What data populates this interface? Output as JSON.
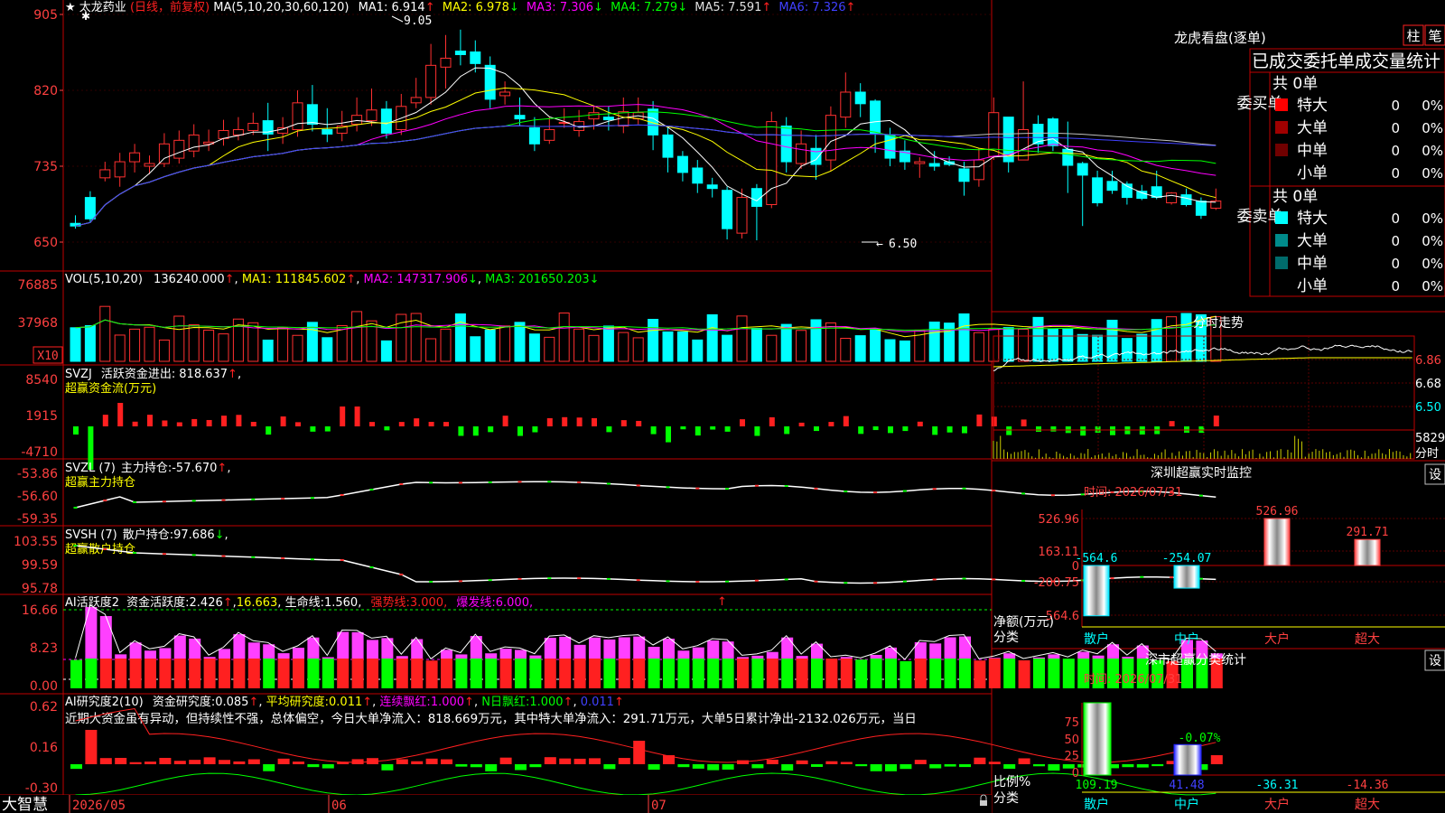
{
  "app": {
    "name": "大智慧",
    "date_start": "2026/05",
    "date_06": "06",
    "date_07": "07"
  },
  "stock": {
    "name": "太龙药业",
    "mode": "(日线，前复权)",
    "star": "★"
  },
  "price_panel": {
    "yticks": [
      "905",
      "820",
      "735",
      "650"
    ],
    "ma_label": "MA(5,10,20,30,60,120)",
    "ma": [
      {
        "name": "MA1",
        "value": "6.914",
        "arrow": "↑",
        "color": "#ffffff"
      },
      {
        "name": "MA2",
        "value": "6.978",
        "arrow": "↓",
        "color": "#ffff00"
      },
      {
        "name": "MA3",
        "value": "7.306",
        "arrow": "↓",
        "color": "#ff00ff"
      },
      {
        "name": "MA4",
        "value": "7.279",
        "arrow": "↓",
        "color": "#00ff00"
      },
      {
        "name": "MA5",
        "value": "7.591",
        "arrow": "↑",
        "color": "#c0c0c0"
      },
      {
        "name": "MA6",
        "value": "7.326",
        "arrow": "↑",
        "color": "#4040ff"
      }
    ],
    "high_mark": "9.05",
    "low_mark": "6.50"
  },
  "volume_panel": {
    "label": "VOL(5,10,20)",
    "value": "136240.000",
    "ma": [
      {
        "name": "MA1",
        "value": "111845.602",
        "arrow": "↑",
        "color": "#ffff00"
      },
      {
        "name": "MA2",
        "value": "147317.906",
        "arrow": "↓",
        "color": "#ff00ff"
      },
      {
        "name": "MA3",
        "value": "201650.203",
        "arrow": "↓",
        "color": "#00ff00"
      }
    ],
    "yticks": [
      "76885",
      "37968"
    ],
    "unit": "X10"
  },
  "svzj_panel": {
    "label": "SVZJ",
    "title": "活跃资金进出:",
    "value": "818.637",
    "subtitle": "超赢资金流(万元)",
    "yticks": [
      "8540",
      "1915",
      "-4710"
    ]
  },
  "svzl_panel": {
    "label": "SVZL (7)",
    "title": "主力持仓:",
    "value": "-57.670",
    "subtitle": "超赢主力持仓",
    "yticks": [
      "-53.86",
      "-56.60",
      "-59.35"
    ]
  },
  "svsh_panel": {
    "label": "SVSH (7)",
    "title": "散户持仓:",
    "value": "97.686",
    "subtitle": "超赢散户持仓",
    "yticks": [
      "103.55",
      "99.59",
      "95.78"
    ]
  },
  "ai_active_panel": {
    "label": "AI活跃度2",
    "title": "资金活跃度:",
    "value1": "2.426",
    "value2": "16.663",
    "life_label": "生命线:",
    "life_value": "1.560",
    "strong_label": "强势线:",
    "strong_value": "3.000",
    "burst_label": "爆发线:",
    "burst_value": "6.000",
    "yticks": [
      "16.66",
      "8.23",
      "0.00"
    ]
  },
  "ai_research_panel": {
    "label": "AI研究度2(10)",
    "title": "资金研究度:",
    "value": "0.085",
    "avg_label": "平均研究度:",
    "avg_value": "0.011",
    "red1_label": "连续飘红:",
    "red1_value": "1.000",
    "red2_label": "N日飘红:",
    "red2_value": "1.000",
    "last_value": "0.011",
    "comment": "近期大资金虽有异动，但持续性不强，总体偏空，今日大单净流入：818.669万元，其中特大单净流入：291.71万元，大单5日累计净出-2132.026万元，当日",
    "yticks": [
      "0.62",
      "0.16",
      "-0.30"
    ]
  },
  "lhb": {
    "title": "龙虎看盘(逐单)",
    "btn1": "柱",
    "btn2": "笔",
    "stats_title": "已成交委托单成交量统计",
    "buy": {
      "side": "委买单",
      "total": "共 0单",
      "rows": [
        {
          "label": "特大",
          "count": "0",
          "pct": "0%",
          "color": "#ff0000"
        },
        {
          "label": "大单",
          "count": "0",
          "pct": "0%",
          "color": "#a00000"
        },
        {
          "label": "中单",
          "count": "0",
          "pct": "0%",
          "color": "#700000"
        },
        {
          "label": "小单",
          "count": "0",
          "pct": "0%",
          "color": ""
        }
      ]
    },
    "sell": {
      "side": "委卖单",
      "total": "共 0单",
      "rows": [
        {
          "label": "特大",
          "count": "0",
          "pct": "0%",
          "color": "#00ffff"
        },
        {
          "label": "大单",
          "count": "0",
          "pct": "0%",
          "color": "#008b8b"
        },
        {
          "label": "中单",
          "count": "0",
          "pct": "0%",
          "color": "#006b6b"
        },
        {
          "label": "小单",
          "count": "0",
          "pct": "0%",
          "color": ""
        }
      ]
    }
  },
  "intraday": {
    "title": "分时走势",
    "yticks": [
      "6.86",
      "6.68",
      "6.50"
    ],
    "vol_label": "5829",
    "vol_unit": "分时"
  },
  "monitor": {
    "title": "深圳超赢实时监控",
    "btn": "设",
    "time": "时间: 2026/07/31",
    "yticks": [
      "526.96",
      "163.11",
      "0",
      "-200.75",
      "-564.6"
    ],
    "ylabel": "净额(万元)",
    "xlabel": "分类",
    "categories": [
      {
        "name": "散户",
        "value": "-564.6"
      },
      {
        "name": "中户",
        "value": "-254.07"
      },
      {
        "name": "大户",
        "value": "526.96"
      },
      {
        "name": "超大",
        "value": "291.71"
      }
    ]
  },
  "classify": {
    "title": "深市超赢分类统计",
    "btn": "设",
    "time": "时间: 2026/07/31",
    "yticks": [
      "75",
      "50",
      "25",
      "0"
    ],
    "ylabel": "比例%",
    "xlabel": "分类",
    "bar_note": "-0.07%",
    "categories": [
      {
        "name": "散户",
        "value": "109.19"
      },
      {
        "name": "中户",
        "value": "41.48"
      },
      {
        "name": "大户",
        "value": "-36.31"
      },
      {
        "name": "超大",
        "value": "-14.36"
      }
    ]
  },
  "chart_data": [
    {
      "type": "bar",
      "title": "深圳超赢实时监控",
      "categories": [
        "散户",
        "中户",
        "大户",
        "超大"
      ],
      "values": [
        -564.6,
        -254.07,
        526.96,
        291.71
      ],
      "ylabel": "净额(万元)",
      "ylim": [
        -564.6,
        526.96
      ]
    },
    {
      "type": "bar",
      "title": "深市超赢分类统计",
      "categories": [
        "散户",
        "中户",
        "大户",
        "超大"
      ],
      "values": [
        109.19,
        41.48,
        -36.31,
        -14.36
      ],
      "ylabel": "比例%",
      "ylim": [
        0,
        75
      ]
    }
  ],
  "candles": [
    [
      671,
      668,
      680,
      665
    ],
    [
      700,
      676,
      707,
      672
    ],
    [
      722,
      731,
      740,
      718
    ],
    [
      723,
      740,
      750,
      712
    ],
    [
      740,
      750,
      760,
      728
    ],
    [
      735,
      738,
      747,
      726
    ],
    [
      738,
      760,
      772,
      734
    ],
    [
      744,
      764,
      775,
      738
    ],
    [
      752,
      770,
      782,
      745
    ],
    [
      760,
      762,
      776,
      752
    ],
    [
      766,
      775,
      787,
      758
    ],
    [
      770,
      776,
      790,
      764
    ],
    [
      775,
      783,
      795,
      770
    ],
    [
      786,
      771,
      806,
      752
    ],
    [
      772,
      778,
      790,
      760
    ],
    [
      776,
      806,
      820,
      768
    ],
    [
      804,
      782,
      826,
      774
    ],
    [
      776,
      771,
      800,
      762
    ],
    [
      772,
      780,
      797,
      763
    ],
    [
      782,
      792,
      812,
      774
    ],
    [
      786,
      798,
      822,
      780
    ],
    [
      799,
      772,
      808,
      766
    ],
    [
      776,
      802,
      816,
      770
    ],
    [
      806,
      812,
      834,
      800
    ],
    [
      812,
      848,
      872,
      804
    ],
    [
      846,
      856,
      882,
      822
    ],
    [
      864,
      860,
      888,
      848
    ],
    [
      863,
      850,
      876,
      840
    ],
    [
      848,
      810,
      858,
      800
    ],
    [
      814,
      818,
      830,
      804
    ],
    [
      792,
      788,
      812,
      780
    ],
    [
      778,
      760,
      790,
      752
    ],
    [
      764,
      776,
      790,
      760
    ],
    [
      784,
      784,
      800,
      778
    ],
    [
      775,
      785,
      798,
      768
    ],
    [
      788,
      795,
      803,
      776
    ],
    [
      790,
      787,
      802,
      775
    ],
    [
      780,
      796,
      812,
      772
    ],
    [
      788,
      795,
      812,
      782
    ],
    [
      799,
      770,
      808,
      753
    ],
    [
      770,
      745,
      780,
      728
    ],
    [
      746,
      728,
      752,
      718
    ],
    [
      733,
      716,
      742,
      705
    ],
    [
      714,
      710,
      722,
      700
    ],
    [
      708,
      665,
      712,
      653
    ],
    [
      660,
      700,
      710,
      654
    ],
    [
      710,
      690,
      715,
      652
    ],
    [
      692,
      785,
      796,
      688
    ],
    [
      780,
      740,
      790,
      728
    ],
    [
      738,
      760,
      775,
      732
    ],
    [
      755,
      737,
      770,
      720
    ],
    [
      742,
      792,
      802,
      730
    ],
    [
      790,
      818,
      840,
      778
    ],
    [
      818,
      805,
      828,
      790
    ],
    [
      808,
      772,
      810,
      750
    ],
    [
      770,
      744,
      778,
      735
    ],
    [
      752,
      740,
      764,
      731
    ],
    [
      738,
      740,
      745,
      722
    ],
    [
      738,
      735,
      752,
      730
    ],
    [
      740,
      737,
      746,
      735
    ],
    [
      732,
      718,
      740,
      702
    ],
    [
      720,
      742,
      755,
      712
    ],
    [
      746,
      795,
      812,
      742
    ],
    [
      790,
      740,
      790,
      728
    ],
    [
      742,
      776,
      830,
      770
    ],
    [
      782,
      760,
      792,
      750
    ],
    [
      788,
      758,
      790,
      752
    ],
    [
      754,
      736,
      785,
      705
    ],
    [
      738,
      725,
      740,
      668
    ],
    [
      722,
      694,
      730,
      690
    ],
    [
      718,
      708,
      730,
      704
    ],
    [
      715,
      700,
      718,
      692
    ],
    [
      707,
      699,
      714,
      697
    ],
    [
      712,
      700,
      730,
      698
    ],
    [
      694,
      705,
      706,
      692
    ],
    [
      703,
      692,
      710,
      690
    ],
    [
      696,
      680,
      700,
      676
    ],
    [
      688,
      696,
      710,
      686
    ]
  ]
}
